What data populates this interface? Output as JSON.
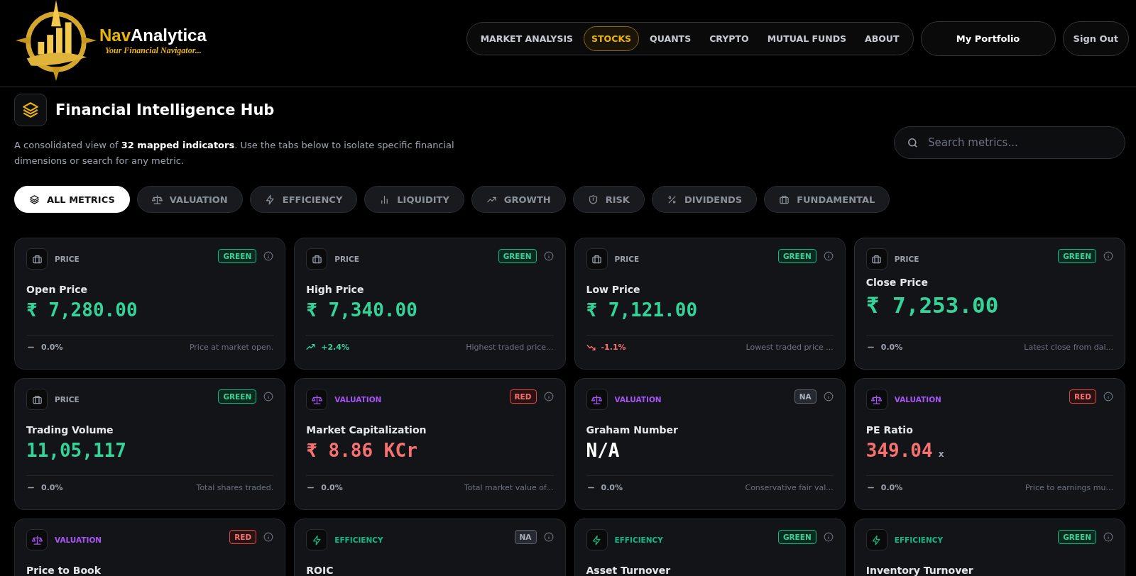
{
  "logo": {
    "name_part_1": "Nav",
    "name_part_2": "Analytica",
    "tagline": "Your Financial Navigator..."
  },
  "nav": {
    "items": [
      {
        "label": "MARKET ANALYSIS",
        "selected": false
      },
      {
        "label": "STOCKS",
        "selected": true
      },
      {
        "label": "QUANTS",
        "selected": false
      },
      {
        "label": "CRYPTO",
        "selected": false
      },
      {
        "label": "MUTUAL FUNDS",
        "selected": false
      },
      {
        "label": "ABOUT",
        "selected": false
      }
    ],
    "portfolio_button": "My Portfolio",
    "sign_out_button": "Sign Out"
  },
  "hub": {
    "title": "Financial Intelligence Hub",
    "description": "A consolidated view of **32 mapped indicators**. Use the tabs below to isolate specific financial dimensions or search for any metric.",
    "search": {
      "placeholder": "Search metrics..."
    }
  },
  "tabs": [
    {
      "label": "ALL METRICS",
      "kind": "layers",
      "selected": true
    },
    {
      "label": "VALUATION",
      "kind": "scale",
      "selected": false
    },
    {
      "label": "EFFICIENCY",
      "kind": "bolt",
      "selected": false
    },
    {
      "label": "LIQUIDITY",
      "kind": "bars",
      "selected": false
    },
    {
      "label": "GROWTH",
      "kind": "trend",
      "selected": false
    },
    {
      "label": "RISK",
      "kind": "shield",
      "selected": false
    },
    {
      "label": "DIVIDENDS",
      "kind": "percent",
      "selected": false
    },
    {
      "label": "FUNDAMENTAL",
      "kind": "briefcase",
      "selected": false
    }
  ],
  "cards": [
    {
      "category": "PRICE",
      "kind": "price",
      "status": {
        "label": "GREEN",
        "kind": "green"
      },
      "name": "Open Price",
      "value": "₹ 7,280.00",
      "change": {
        "kind": "flat",
        "text": "0.0%"
      },
      "note": "Price at market open.",
      "hovered": false
    },
    {
      "category": "PRICE",
      "kind": "price",
      "status": {
        "label": "GREEN",
        "kind": "green"
      },
      "name": "High Price",
      "value": "₹ 7,340.00",
      "change": {
        "kind": "up",
        "text": "+2.4%"
      },
      "note": "Highest traded price...",
      "hovered": false
    },
    {
      "category": "PRICE",
      "kind": "price",
      "status": {
        "label": "GREEN",
        "kind": "green"
      },
      "name": "Low Price",
      "value": "₹ 7,121.00",
      "change": {
        "kind": "down",
        "text": "-1.1%"
      },
      "note": "Lowest traded price ...",
      "hovered": false
    },
    {
      "category": "PRICE",
      "kind": "price",
      "status": {
        "label": "GREEN",
        "kind": "green"
      },
      "name": "Close Price",
      "value": "₹ 7,253.00",
      "change": {
        "kind": "flat",
        "text": "0.0%"
      },
      "note": "Latest close from dai...",
      "hovered": true
    },
    {
      "category": "PRICE",
      "kind": "price",
      "status": {
        "label": "GREEN",
        "kind": "green"
      },
      "name": "Trading Volume",
      "value": "11,05,117",
      "change": {
        "kind": "flat",
        "text": "0.0%"
      },
      "note": "Total shares traded.",
      "hovered": false
    },
    {
      "category": "VALUATION",
      "kind": "valuation",
      "status": {
        "label": "RED",
        "kind": "red"
      },
      "name": "Market Capitalization",
      "value": "₹ 8.86 KCr",
      "change": {
        "kind": "flat",
        "text": "0.0%"
      },
      "note": "Total market value of...",
      "hovered": false
    },
    {
      "category": "VALUATION",
      "kind": "valuation",
      "status": {
        "label": "NA",
        "kind": "na"
      },
      "name": "Graham Number",
      "value": "N/A",
      "change": {
        "kind": "flat",
        "text": "0.0%"
      },
      "note": "Conservative fair val...",
      "hovered": false
    },
    {
      "category": "VALUATION",
      "kind": "valuation",
      "status": {
        "label": "RED",
        "kind": "red"
      },
      "name": "PE Ratio",
      "value": "349.04",
      "unit": "x",
      "change": {
        "kind": "flat",
        "text": "0.0%"
      },
      "note": "Price to earnings mu...",
      "hovered": false
    },
    {
      "category": "VALUATION",
      "kind": "valuation",
      "status": {
        "label": "RED",
        "kind": "red"
      },
      "name": "Price to Book",
      "hovered": false
    },
    {
      "category": "EFFICIENCY",
      "kind": "efficiency",
      "status": {
        "label": "NA",
        "kind": "na"
      },
      "name": "ROIC",
      "hovered": false
    },
    {
      "category": "EFFICIENCY",
      "kind": "efficiency",
      "status": {
        "label": "GREEN",
        "kind": "green"
      },
      "name": "Asset Turnover",
      "hovered": false
    },
    {
      "category": "EFFICIENCY",
      "kind": "efficiency",
      "status": {
        "label": "GREEN",
        "kind": "green"
      },
      "name": "Inventory Turnover",
      "hovered": false
    }
  ]
}
